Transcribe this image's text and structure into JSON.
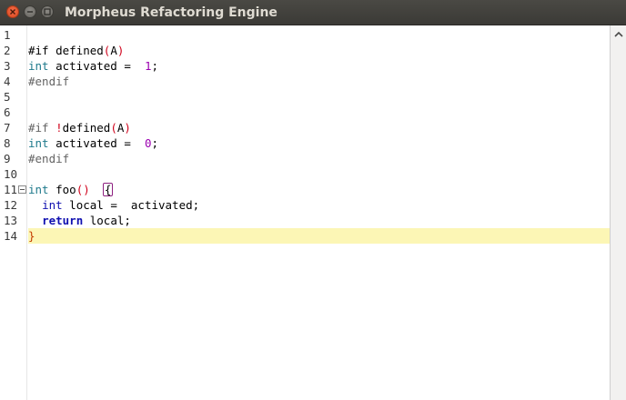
{
  "window": {
    "title": "Morpheus Refactoring Engine"
  },
  "editor": {
    "lines": [
      {
        "num": "1",
        "tokens": []
      },
      {
        "num": "2",
        "tokens": [
          {
            "t": "#if ",
            "c": "plain"
          },
          {
            "t": "defined",
            "c": "plain"
          },
          {
            "t": "(",
            "c": "paren"
          },
          {
            "t": "A",
            "c": "plain"
          },
          {
            "t": ")",
            "c": "paren"
          }
        ]
      },
      {
        "num": "3",
        "tokens": [
          {
            "t": "int",
            "c": "type"
          },
          {
            "t": " activated =  ",
            "c": "plain"
          },
          {
            "t": "1",
            "c": "number"
          },
          {
            "t": ";",
            "c": "plain"
          }
        ]
      },
      {
        "num": "4",
        "tokens": [
          {
            "t": "#endif",
            "c": "directive"
          }
        ]
      },
      {
        "num": "5",
        "tokens": []
      },
      {
        "num": "6",
        "tokens": []
      },
      {
        "num": "7",
        "tokens": [
          {
            "t": "#if ",
            "c": "directive"
          },
          {
            "t": "!",
            "c": "bang"
          },
          {
            "t": "defined",
            "c": "plain"
          },
          {
            "t": "(",
            "c": "paren"
          },
          {
            "t": "A",
            "c": "plain"
          },
          {
            "t": ")",
            "c": "paren"
          }
        ]
      },
      {
        "num": "8",
        "tokens": [
          {
            "t": "int",
            "c": "type"
          },
          {
            "t": " activated =  ",
            "c": "plain"
          },
          {
            "t": "0",
            "c": "number"
          },
          {
            "t": ";",
            "c": "plain"
          }
        ]
      },
      {
        "num": "9",
        "tokens": [
          {
            "t": "#endif",
            "c": "directive"
          }
        ]
      },
      {
        "num": "10",
        "tokens": []
      },
      {
        "num": "11",
        "fold": true,
        "tokens": [
          {
            "t": "int",
            "c": "type"
          },
          {
            "t": " foo",
            "c": "plain"
          },
          {
            "t": "()",
            "c": "paren"
          },
          {
            "t": "  ",
            "c": "plain"
          },
          {
            "t": "{",
            "c": "bracebox"
          }
        ]
      },
      {
        "num": "12",
        "tokens": [
          {
            "t": "  ",
            "c": "plain"
          },
          {
            "t": "int",
            "c": "keyword-plain"
          },
          {
            "t": " local =  activated;",
            "c": "plain"
          }
        ]
      },
      {
        "num": "13",
        "tokens": [
          {
            "t": "  ",
            "c": "plain"
          },
          {
            "t": "return",
            "c": "keyword"
          },
          {
            "t": " local;",
            "c": "plain"
          }
        ]
      },
      {
        "num": "14",
        "highlight": true,
        "tokens": [
          {
            "t": "}",
            "c": "brace"
          }
        ]
      }
    ]
  },
  "colors": {
    "titlebar": "#3c3b37",
    "current_line": "#fcf6b5",
    "type": "#1f7a8c",
    "keyword": "#1010b0",
    "number": "#9b00b0",
    "paren": "#d0021b"
  }
}
